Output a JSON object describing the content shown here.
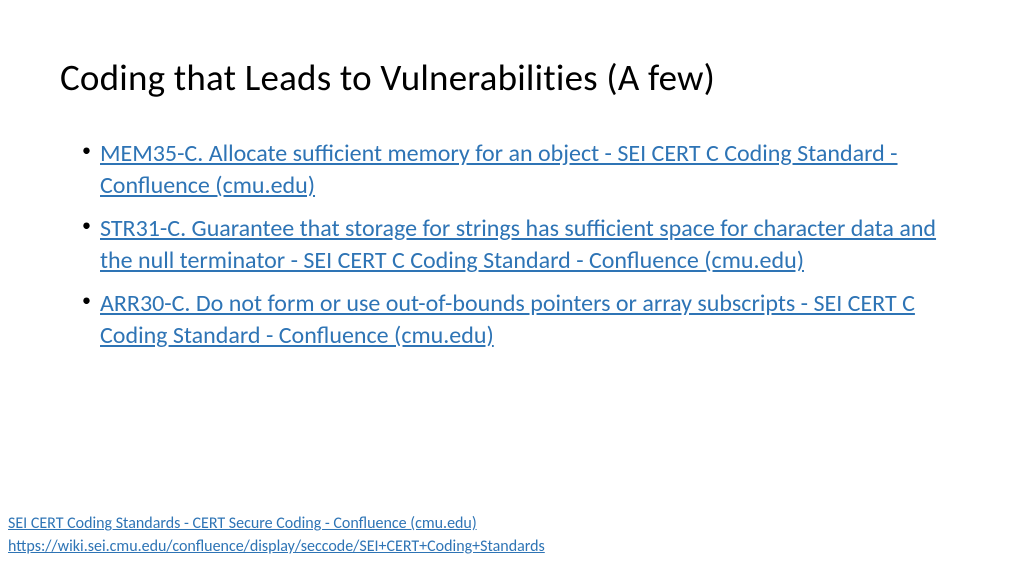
{
  "title": "Coding that Leads to Vulnerabilities (A few)",
  "bullets": [
    "MEM35-C. Allocate sufficient memory for an object - SEI CERT C Coding Standard - Confluence (cmu.edu)",
    "STR31-C. Guarantee that storage for strings has sufficient space for character data and the null terminator - SEI CERT C Coding Standard - Confluence (cmu.edu)",
    "ARR30-C. Do not form or use out-of-bounds pointers or array subscripts - SEI CERT C Coding Standard - Confluence (cmu.edu)"
  ],
  "footer": [
    "SEI CERT Coding Standards - CERT Secure Coding - Confluence (cmu.edu)",
    "https://wiki.sei.cmu.edu/confluence/display/seccode/SEI+CERT+Coding+Standards"
  ]
}
